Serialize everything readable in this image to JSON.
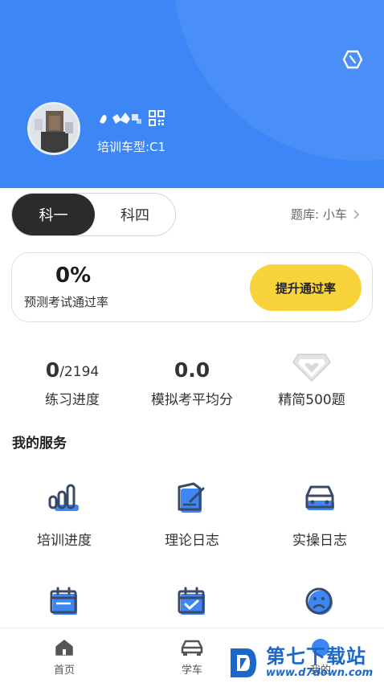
{
  "profile": {
    "car_type": "培训车型:C1"
  },
  "tabs": {
    "active": "科一",
    "inactive": "科四"
  },
  "question_bank": {
    "label": "题库: 小车"
  },
  "pass_rate": {
    "value": "0%",
    "label": "预测考试通过率",
    "button": "提升通过率"
  },
  "stats": {
    "practice": {
      "done": "0",
      "total": "/2194",
      "label": "练习进度"
    },
    "mock": {
      "value": "0.0",
      "label": "模拟考平均分"
    },
    "selected": {
      "label": "精简500题"
    }
  },
  "services": {
    "title": "我的服务",
    "items": [
      {
        "label": "培训进度",
        "icon": "bar-chart-icon"
      },
      {
        "label": "理论日志",
        "icon": "document-edit-icon"
      },
      {
        "label": "实操日志",
        "icon": "car-icon"
      },
      {
        "label": "",
        "icon": "calendar-icon"
      },
      {
        "label": "",
        "icon": "calendar-check-icon"
      },
      {
        "label": "",
        "icon": "sad-face-icon"
      }
    ]
  },
  "tabbar": {
    "home": "首页",
    "car": "学车",
    "mine": "我的"
  },
  "watermark": {
    "main": "第七下载站",
    "sub": "www.d7down.com"
  },
  "colors": {
    "header_blue": "#3d86f5",
    "accent_yellow": "#f9d33a",
    "icon_blue": "#3d86f5",
    "icon_dark": "#3a4a66",
    "watermark_blue": "#1d67c9"
  }
}
